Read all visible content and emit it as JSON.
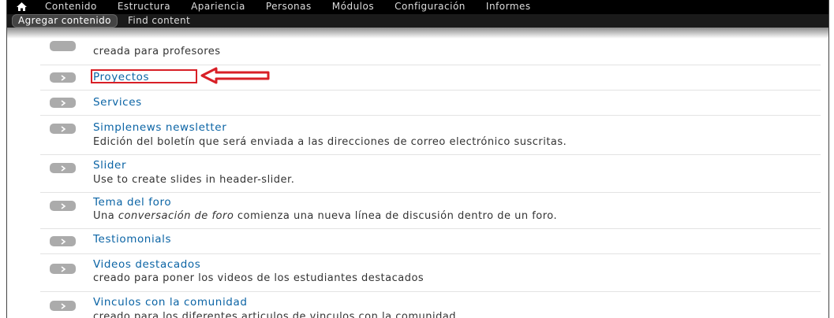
{
  "toolbar": {
    "menu": [
      "Contenido",
      "Estructura",
      "Apariencia",
      "Personas",
      "Módulos",
      "Configuración",
      "Informes"
    ],
    "shortcuts": [
      "Agregar contenido",
      "Find content"
    ],
    "icons": {
      "home": "home-icon"
    }
  },
  "content_types": [
    {
      "title": "",
      "description": "creada para profesores"
    },
    {
      "title": "Proyectos",
      "description": ""
    },
    {
      "title": "Services",
      "description": ""
    },
    {
      "title": "Simplenews newsletter",
      "description": "Edición del boletín que será enviada a las direcciones de correo electrónico suscritas."
    },
    {
      "title": "Slider",
      "description": "Use to create slides in header-slider."
    },
    {
      "title": "Tema del foro",
      "description_prefix": "Una ",
      "description_em": "conversación de foro",
      "description_suffix": " comienza una nueva línea de discusión dentro de un foro."
    },
    {
      "title": "Testiomonials",
      "description": ""
    },
    {
      "title": "Videos destacados",
      "description": "creado para poner los videos de los estudiantes destacados"
    },
    {
      "title": "Vinculos con la comunidad",
      "description": "creado para los diferentes articulos de vinculos con la comunidad"
    }
  ],
  "annotation": {
    "highlight_color": "#d81f26"
  },
  "colors": {
    "link": "#0b64a5",
    "toolbar": "#000000"
  }
}
